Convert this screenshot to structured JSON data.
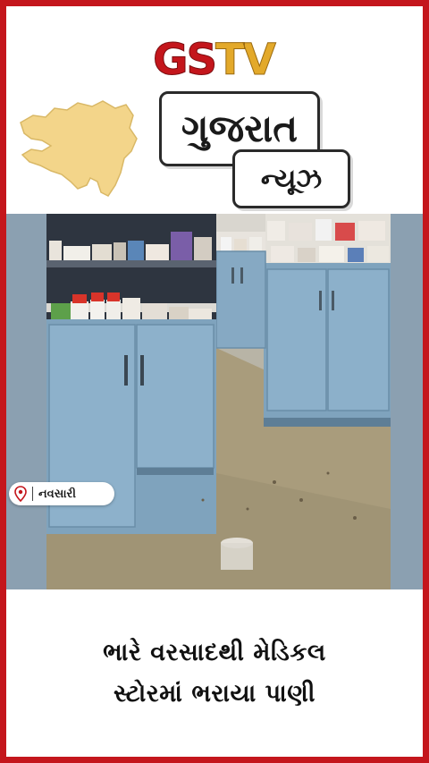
{
  "brand": {
    "logo_left": "GS",
    "logo_right": "TV"
  },
  "section": {
    "title": "ગુજરાત",
    "subtitle": "ન્યૂઝ"
  },
  "location": {
    "label": "નવસારી"
  },
  "headline": {
    "line1": "ભારે વરસાદથી મેડિકલ",
    "line2": "સ્ટોરમાં ભરાયા પાણી"
  },
  "colors": {
    "frame": "#c4161c",
    "logo_gold": "#e3a92a",
    "map_fill": "#f3d58a"
  }
}
